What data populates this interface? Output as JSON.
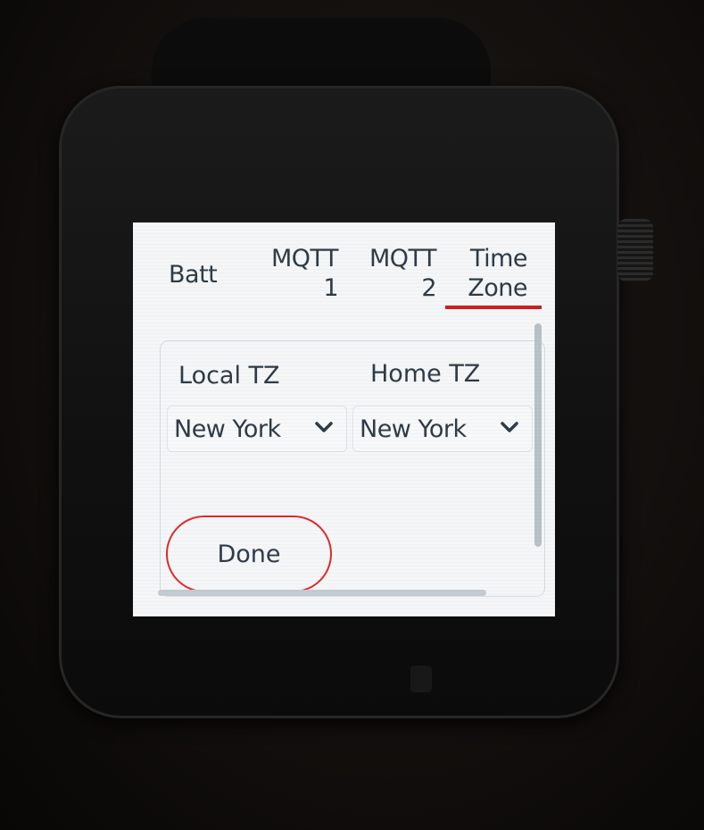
{
  "tabs": [
    {
      "id": "batt",
      "lines": [
        "Batt"
      ],
      "selected": false
    },
    {
      "id": "mqtt1",
      "lines": [
        "MQTT",
        "1"
      ],
      "selected": false
    },
    {
      "id": "mqtt2",
      "lines": [
        "MQTT",
        "2"
      ],
      "selected": false
    },
    {
      "id": "timezone",
      "lines": [
        "Time",
        "Zone"
      ],
      "selected": true
    }
  ],
  "timezone": {
    "local_label": "Local TZ",
    "home_label": "Home TZ",
    "local_value": "New York",
    "home_value": "New York"
  },
  "done_label": "Done",
  "icons": {
    "select_chevron": "chevron-down-icon"
  },
  "colors": {
    "accent": "#e02a2a",
    "text": "#2f3b46",
    "screen_bg": "#f4f6f7"
  }
}
